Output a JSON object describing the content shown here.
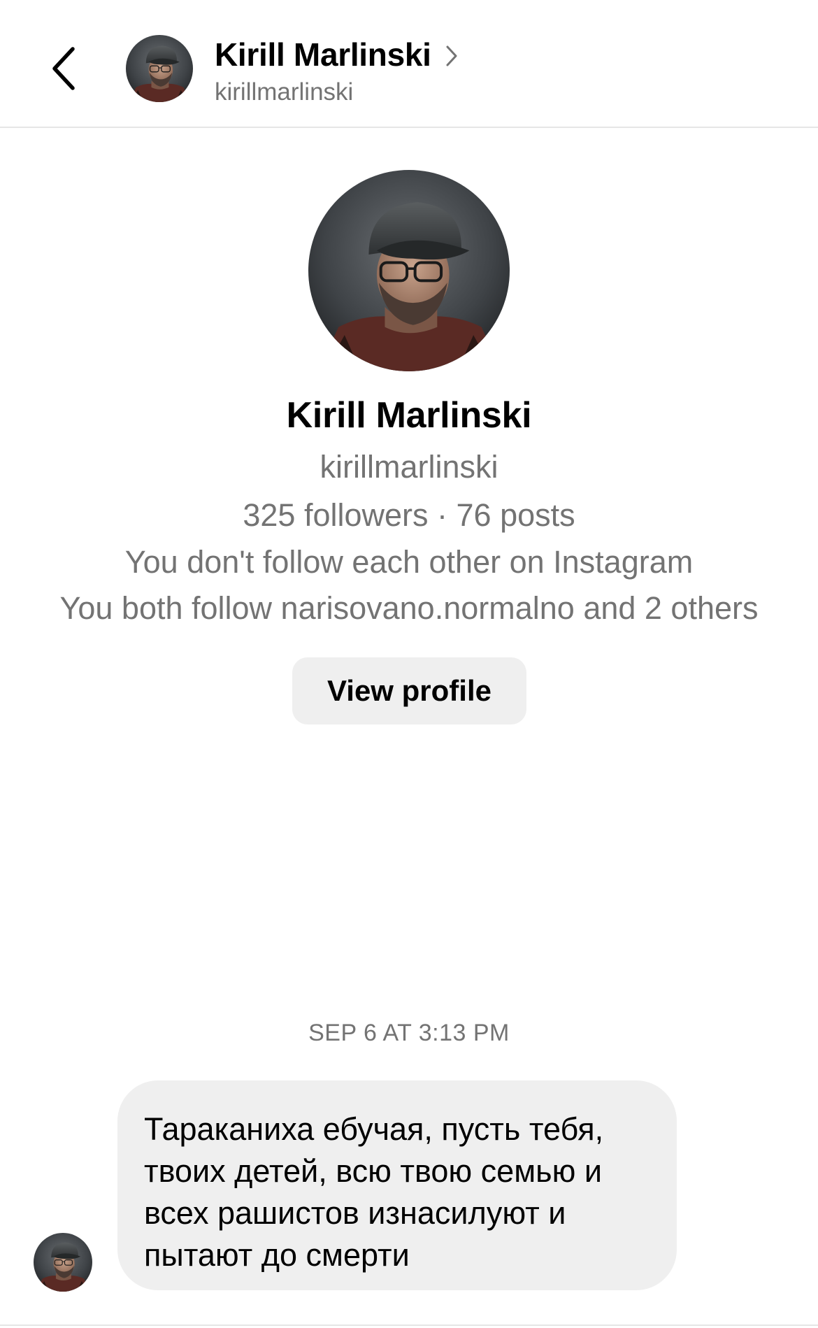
{
  "header": {
    "back_icon": "chevron-left-icon",
    "name": "Kirill Marlinski",
    "username": "kirillmarlinski",
    "chevron_icon": "chevron-right-icon"
  },
  "profile": {
    "name": "Kirill Marlinski",
    "username": "kirillmarlinski",
    "stats": "325 followers · 76 posts",
    "follow_status": "You don't follow each other on Instagram",
    "mutual": "You both follow narisovano.normalno and 2 others",
    "view_profile_label": "View profile"
  },
  "conversation": {
    "timestamp": "SEP 6 AT 3:13 PM",
    "messages": [
      {
        "text": "Тараканиха ебучая, пусть тебя,\nтвоих детей, всю твою семью и\nвсех рашистов изнасилуют и\nпытают до смерти"
      }
    ]
  },
  "colors": {
    "secondary_text": "#737373",
    "bubble_bg": "#efefef",
    "divider": "#e6e6e6"
  }
}
